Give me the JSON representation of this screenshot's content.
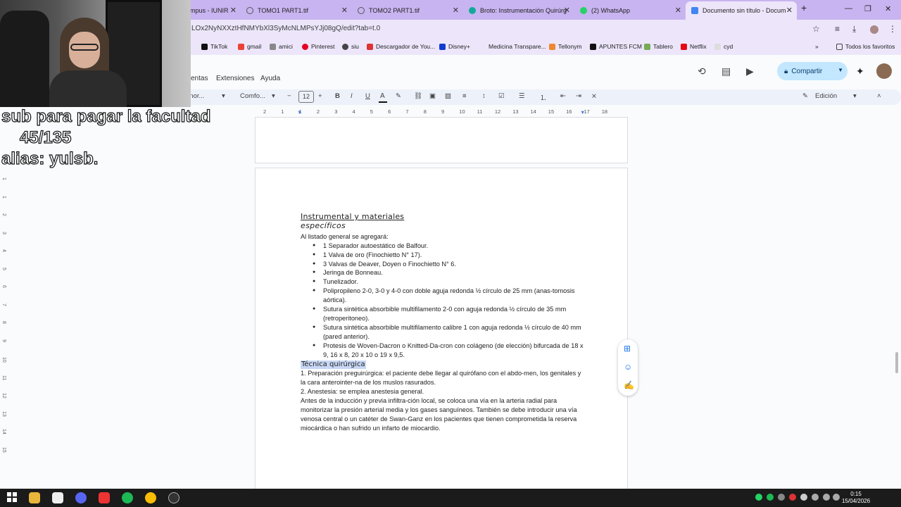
{
  "browser": {
    "tabs": [
      {
        "title": "mpus - IUNIR",
        "color": "#6a4"
      },
      {
        "title": "TOMO1 PART1.tif",
        "color": "#555"
      },
      {
        "title": "TOMO2 PART1.tif",
        "color": "#555"
      },
      {
        "title": "Broto: Instrumentación Quirúrg",
        "color": "#1a9"
      },
      {
        "title": "(2) WhatsApp",
        "color": "#25d366"
      },
      {
        "title": "Documento sin título - Docum",
        "color": "#4285f4",
        "active": true
      }
    ],
    "new_tab": "+",
    "window_controls": [
      "—",
      "❐",
      "✕"
    ],
    "url": "LOx2NyNXXztHfNMYbXl3SyMcNLMPsYJj08gQ/edit?tab=t.0",
    "bookmarks": [
      "TikTok",
      "gmail",
      "amici",
      "Pinterest",
      "siu",
      "Descargador de You...",
      "Disney+",
      "Medicina Transpare...",
      "Tellonym",
      "APUNTES FCM",
      "Tablero",
      "Netflix",
      "cyd"
    ],
    "bookmarks_more": "»",
    "all_bookmarks": "Todos los favoritos"
  },
  "docs": {
    "menus": [
      "entas",
      "Extensiones",
      "Ayuda"
    ],
    "share_label": "Compartir",
    "mode_label": "Edición",
    "toolbar": {
      "style": "xto nor...",
      "font": "Comfo...",
      "font_size": "12",
      "bold": "B",
      "italic": "I",
      "underline": "U",
      "text_color": "A"
    },
    "ruler_ticks": [
      "2",
      "1",
      "1",
      "2",
      "3",
      "4",
      "5",
      "6",
      "7",
      "8",
      "9",
      "10",
      "11",
      "12",
      "13",
      "14",
      "15",
      "16",
      "17",
      "18"
    ],
    "vruler_ticks": [
      "1",
      "1",
      "2",
      "3",
      "4",
      "5",
      "6",
      "7",
      "8",
      "9",
      "10",
      "11",
      "12",
      "13",
      "14",
      "15"
    ]
  },
  "document": {
    "heading1": "Instrumental y materiales",
    "heading2": "específicos",
    "intro": "Al listado general se agregará:",
    "items": [
      "1 Separador autoestático de Balfour.",
      "1 Valva de oro (Finochietto N° 17).",
      "3 Valvas de Deaver, Doyen o Finochietto N° 6.",
      "Jeringa de Bonneau.",
      "Tunelizador.",
      "Polipropileno 2-0, 3-0 y 4-0 con doble aguja redonda ½ círculo de 25 mm (anas-tomosis aórtica).",
      "Sutura sintética absorbible multifilamento 2-0 con aguja redonda ½ círculo de 35 mm (retroperitoneo).",
      "Sutura sintética absorbible multifilamento calibre 1 con aguja redonda ½ círculo de 40 mm (pared anterior).",
      "Protesis de Woven-Dacron o Knitted-Da-cron con colágeno (de elección) bifurcada de 18 x 9, 16 x 8, 20 x 10 o 19 x 9,5."
    ],
    "heading3": "Técnica quirúrgica",
    "para1": "1. Preparación preguirúrgica: el paciente debe llegar al quirófano con el abdo-men, los genitales y la cara anterointer-na de los muslos rasurados.",
    "para2": "2. Anestesia: se emplea anestesia general.",
    "para3": "Antes de la inducción y previa infiltra-ción local, se coloca una vía en la arteria radial para monitorizar la presión arterial media y los gases sanguíneos. También se debe introducir una vía venosa central o un catéter de Swan-Ganz en los pacientes que tienen comprometida la reserva miocárdica o han sufrido un infarto de miocardio."
  },
  "overlay": {
    "line1": "sub para pagar la facultad",
    "line2": "45/135",
    "line3": "alias: yulsb."
  },
  "taskbar": {
    "time": "0:15",
    "date": "15/04/2026"
  }
}
